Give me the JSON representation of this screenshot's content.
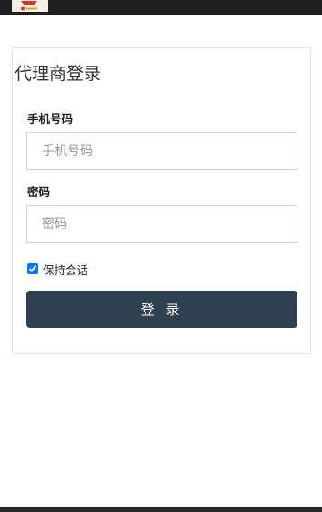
{
  "header": {
    "logo_icon": "brand-logo-icon"
  },
  "login": {
    "title": "代理商登录",
    "phone_label": "手机号码",
    "phone_placeholder": "手机号码",
    "phone_value": "",
    "password_label": "密码",
    "password_placeholder": "密码",
    "password_value": "",
    "remember_label": "保持会话",
    "remember_checked": true,
    "submit_label": "登 录"
  },
  "colors": {
    "button_bg": "#2f4050",
    "top_bar": "#1f1f1f",
    "panel_border": "#e4e4e4"
  }
}
